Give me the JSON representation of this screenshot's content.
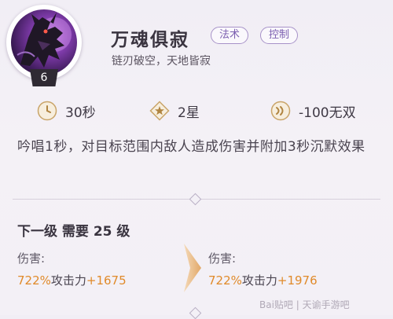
{
  "skill": {
    "name": "万魂俱寂",
    "tags": [
      "法术",
      "控制"
    ],
    "subtitle": "链刃破空，天地皆寂",
    "level": "6"
  },
  "stats": [
    {
      "icon": "clock-icon",
      "value": "30秒"
    },
    {
      "icon": "star-icon",
      "value": "2星"
    },
    {
      "icon": "energy-icon",
      "value": "-100无双"
    }
  ],
  "description": "吟唱1秒，对目标范围内敌人造成伤害并附加3秒沉默效果",
  "next_level": {
    "title": "下一级 需要 25 级",
    "current": {
      "label": "伤害:",
      "percent": "722%",
      "stat": "攻击力",
      "bonus": "+1675"
    },
    "next": {
      "label": "伤害:",
      "percent": "722%",
      "stat": "攻击力",
      "bonus": "+1976"
    }
  },
  "watermark": "Bai贴吧 | 天谕手游吧",
  "colors": {
    "accent": "#e08a2a",
    "tag_border": "#a792c8",
    "tag_text": "#7c5fb0",
    "background": "#f3f0f6"
  }
}
